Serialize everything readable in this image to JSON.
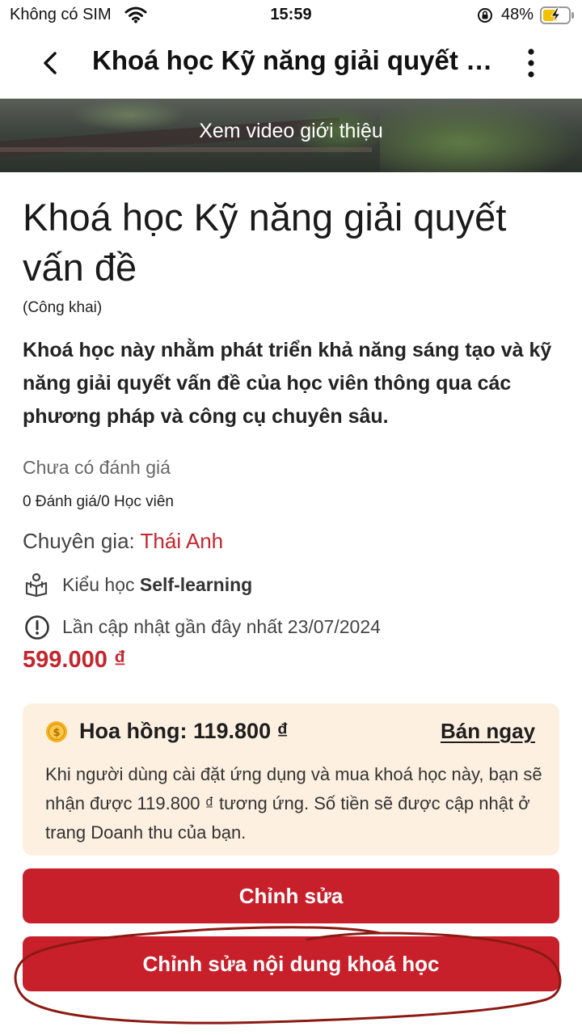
{
  "status_bar": {
    "carrier": "Không có SIM",
    "time": "15:59",
    "battery_percent": "48%"
  },
  "nav": {
    "title": "Khoá học Kỹ năng giải quyết v..."
  },
  "banner": {
    "label": "Xem video giới thiệu"
  },
  "course": {
    "title": "Khoá học Kỹ năng giải quyết vấn đề",
    "visibility": "(Công khai)",
    "description": "Khoá học này nhằm phát triển khả năng sáng tạo và kỹ năng giải quyết vấn đề của học viên thông qua các phương pháp và công cụ chuyên sâu.",
    "rating_status": "Chưa có đánh giá",
    "rating_count": "0 Đánh giá/0 Học viên",
    "expert_label": "Chuyên gia: ",
    "expert_name": "Thái Anh",
    "learn_type_label": "Kiểu học ",
    "learn_type_value": "Self-learning",
    "last_updated": "Lần cập nhật gần đây nhất 23/07/2024",
    "price": "599.000 ₫"
  },
  "commission": {
    "label": "Hoa hồng: 119.800 ₫",
    "sell_now": "Bán ngay",
    "description": "Khi người dùng cài đặt ứng dụng và mua khoá học này, bạn sẽ nhận được 119.800 ₫ tương ứng. Số tiền sẽ được cập nhật ở trang Doanh thu của bạn."
  },
  "buttons": {
    "edit": "Chỉnh sửa",
    "edit_content": "Chỉnh sửa nội dung khoá học"
  },
  "colors": {
    "accent": "#c8202a",
    "commission_bg": "#fdf0e1",
    "annotation": "#8b1a12"
  },
  "icons": [
    "wifi-icon",
    "lock-rotation-icon",
    "battery-charging-icon",
    "back-icon",
    "more-icon",
    "book-reader-icon",
    "info-icon",
    "coin-icon"
  ]
}
